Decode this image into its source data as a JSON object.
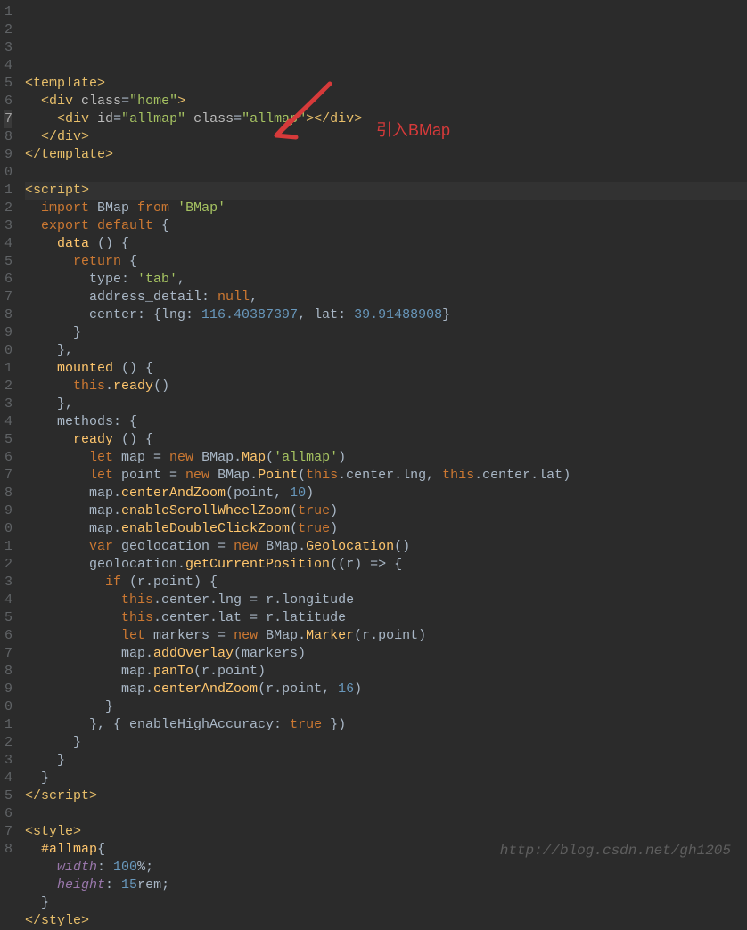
{
  "editor": {
    "highlighted_line": 7,
    "line_numbers": [
      "1",
      "2",
      "3",
      "4",
      "5",
      "6",
      "7",
      "8",
      "9",
      "0",
      "1",
      "2",
      "3",
      "4",
      "5",
      "6",
      "7",
      "8",
      "9",
      "0",
      "1",
      "2",
      "3",
      "4",
      "5",
      "6",
      "7",
      "8",
      "9",
      "0",
      "1",
      "2",
      "3",
      "4",
      "5",
      "6",
      "7",
      "8",
      "9",
      "0",
      "1",
      "2",
      "3",
      "4",
      "5",
      "6",
      "7",
      "8"
    ],
    "lines": {
      "l1": [
        {
          "t": "<",
          "c": "tag"
        },
        {
          "t": "template",
          "c": "tag"
        },
        {
          "t": ">",
          "c": "tag"
        }
      ],
      "l2": [
        {
          "t": "  "
        },
        {
          "t": "<",
          "c": "tag"
        },
        {
          "t": "div ",
          "c": "tag"
        },
        {
          "t": "class",
          "c": "attr"
        },
        {
          "t": "=",
          "c": "op"
        },
        {
          "t": "\"home\"",
          "c": "str"
        },
        {
          "t": ">",
          "c": "tag"
        }
      ],
      "l3": [
        {
          "t": "    "
        },
        {
          "t": "<",
          "c": "tag"
        },
        {
          "t": "div ",
          "c": "tag"
        },
        {
          "t": "id",
          "c": "attr"
        },
        {
          "t": "=",
          "c": "op"
        },
        {
          "t": "\"allmap\"",
          "c": "str"
        },
        {
          "t": " "
        },
        {
          "t": "class",
          "c": "attr"
        },
        {
          "t": "=",
          "c": "op"
        },
        {
          "t": "\"allmap\"",
          "c": "str"
        },
        {
          "t": "></",
          "c": "tag"
        },
        {
          "t": "div",
          "c": "tag"
        },
        {
          "t": ">",
          "c": "tag"
        }
      ],
      "l4": [
        {
          "t": "  "
        },
        {
          "t": "</",
          "c": "tag"
        },
        {
          "t": "div",
          "c": "tag"
        },
        {
          "t": ">",
          "c": "tag"
        }
      ],
      "l5": [
        {
          "t": "</",
          "c": "tag"
        },
        {
          "t": "template",
          "c": "tag"
        },
        {
          "t": ">",
          "c": "tag"
        }
      ],
      "l6": [
        {
          "t": ""
        }
      ],
      "l7": [
        {
          "t": "<",
          "c": "tag"
        },
        {
          "t": "script",
          "c": "tag"
        },
        {
          "t": ">",
          "c": "tag"
        }
      ],
      "l8": [
        {
          "t": "  "
        },
        {
          "t": "import",
          "c": "kw"
        },
        {
          "t": " BMap "
        },
        {
          "t": "from",
          "c": "kw"
        },
        {
          "t": " "
        },
        {
          "t": "'BMap'",
          "c": "str"
        }
      ],
      "l9": [
        {
          "t": "  "
        },
        {
          "t": "export ",
          "c": "kw"
        },
        {
          "t": "default",
          "c": "kw"
        },
        {
          "t": " {"
        }
      ],
      "l10": [
        {
          "t": "    "
        },
        {
          "t": "data",
          "c": "fn"
        },
        {
          "t": " () {"
        }
      ],
      "l11": [
        {
          "t": "      "
        },
        {
          "t": "return",
          "c": "kw"
        },
        {
          "t": " {"
        }
      ],
      "l12": [
        {
          "t": "        type: "
        },
        {
          "t": "'tab'",
          "c": "str"
        },
        {
          "t": ","
        }
      ],
      "l13": [
        {
          "t": "        address_detail: "
        },
        {
          "t": "null",
          "c": "kw"
        },
        {
          "t": ","
        }
      ],
      "l14": [
        {
          "t": "        center: {lng: "
        },
        {
          "t": "116.40387397",
          "c": "num"
        },
        {
          "t": ", lat: "
        },
        {
          "t": "39.91488908",
          "c": "num"
        },
        {
          "t": "}"
        }
      ],
      "l15": [
        {
          "t": "      }"
        }
      ],
      "l16": [
        {
          "t": "    },"
        }
      ],
      "l17": [
        {
          "t": "    "
        },
        {
          "t": "mounted",
          "c": "fn"
        },
        {
          "t": " () {"
        }
      ],
      "l18": [
        {
          "t": "      "
        },
        {
          "t": "this",
          "c": "kw"
        },
        {
          "t": "."
        },
        {
          "t": "ready",
          "c": "fn"
        },
        {
          "t": "()"
        }
      ],
      "l19": [
        {
          "t": "    },"
        }
      ],
      "l20": [
        {
          "t": "    methods: {"
        }
      ],
      "l21": [
        {
          "t": "      "
        },
        {
          "t": "ready",
          "c": "fn"
        },
        {
          "t": " () {"
        }
      ],
      "l22": [
        {
          "t": "        "
        },
        {
          "t": "let",
          "c": "kw"
        },
        {
          "t": " map = "
        },
        {
          "t": "new",
          "c": "kw"
        },
        {
          "t": " BMap."
        },
        {
          "t": "Map",
          "c": "fn"
        },
        {
          "t": "("
        },
        {
          "t": "'allmap'",
          "c": "str"
        },
        {
          "t": ")"
        }
      ],
      "l23": [
        {
          "t": "        "
        },
        {
          "t": "let",
          "c": "kw"
        },
        {
          "t": " point = "
        },
        {
          "t": "new",
          "c": "kw"
        },
        {
          "t": " BMap."
        },
        {
          "t": "Point",
          "c": "fn"
        },
        {
          "t": "("
        },
        {
          "t": "this",
          "c": "kw"
        },
        {
          "t": ".center.lng, "
        },
        {
          "t": "this",
          "c": "kw"
        },
        {
          "t": ".center.lat)"
        }
      ],
      "l24": [
        {
          "t": "        map."
        },
        {
          "t": "centerAndZoom",
          "c": "fn"
        },
        {
          "t": "(point, "
        },
        {
          "t": "10",
          "c": "num"
        },
        {
          "t": ")"
        }
      ],
      "l25": [
        {
          "t": "        map."
        },
        {
          "t": "enableScrollWheelZoom",
          "c": "fn"
        },
        {
          "t": "("
        },
        {
          "t": "true",
          "c": "bool"
        },
        {
          "t": ")"
        }
      ],
      "l26": [
        {
          "t": "        map."
        },
        {
          "t": "enableDoubleClickZoom",
          "c": "fn"
        },
        {
          "t": "("
        },
        {
          "t": "true",
          "c": "bool"
        },
        {
          "t": ")"
        }
      ],
      "l27": [
        {
          "t": "        "
        },
        {
          "t": "var",
          "c": "kw"
        },
        {
          "t": " geolocation = "
        },
        {
          "t": "new",
          "c": "kw"
        },
        {
          "t": " BMap."
        },
        {
          "t": "Geolocation",
          "c": "fn"
        },
        {
          "t": "()"
        }
      ],
      "l28": [
        {
          "t": "        geolocation."
        },
        {
          "t": "getCurrentPosition",
          "c": "fn"
        },
        {
          "t": "((r) => {"
        }
      ],
      "l29": [
        {
          "t": "          "
        },
        {
          "t": "if",
          "c": "kw"
        },
        {
          "t": " (r.point) {"
        }
      ],
      "l30": [
        {
          "t": "            "
        },
        {
          "t": "this",
          "c": "kw"
        },
        {
          "t": ".center.lng = r.longitude"
        }
      ],
      "l31": [
        {
          "t": "            "
        },
        {
          "t": "this",
          "c": "kw"
        },
        {
          "t": ".center.lat = r.latitude"
        }
      ],
      "l32": [
        {
          "t": "            "
        },
        {
          "t": "let",
          "c": "kw"
        },
        {
          "t": " markers = "
        },
        {
          "t": "new",
          "c": "kw"
        },
        {
          "t": " BMap."
        },
        {
          "t": "Marker",
          "c": "fn"
        },
        {
          "t": "(r.point)"
        }
      ],
      "l33": [
        {
          "t": "            map."
        },
        {
          "t": "addOverlay",
          "c": "fn"
        },
        {
          "t": "(markers)"
        }
      ],
      "l34": [
        {
          "t": "            map."
        },
        {
          "t": "panTo",
          "c": "fn"
        },
        {
          "t": "(r.point)"
        }
      ],
      "l35": [
        {
          "t": "            map."
        },
        {
          "t": "centerAndZoom",
          "c": "fn"
        },
        {
          "t": "(r.point, "
        },
        {
          "t": "16",
          "c": "num"
        },
        {
          "t": ")"
        }
      ],
      "l36": [
        {
          "t": "          }"
        }
      ],
      "l37": [
        {
          "t": "        }, { enableHighAccuracy: "
        },
        {
          "t": "true",
          "c": "bool"
        },
        {
          "t": " })"
        }
      ],
      "l38": [
        {
          "t": "      }"
        }
      ],
      "l39": [
        {
          "t": "    }"
        }
      ],
      "l40": [
        {
          "t": "  }"
        }
      ],
      "l41": [
        {
          "t": "</",
          "c": "tag"
        },
        {
          "t": "script",
          "c": "tag"
        },
        {
          "t": ">",
          "c": "tag"
        }
      ],
      "l42": [
        {
          "t": ""
        }
      ],
      "l43": [
        {
          "t": "<",
          "c": "tag"
        },
        {
          "t": "style",
          "c": "tag"
        },
        {
          "t": ">",
          "c": "tag"
        }
      ],
      "l44": [
        {
          "t": "  "
        },
        {
          "t": "#allmap",
          "c": "id"
        },
        {
          "t": "{"
        }
      ],
      "l45": [
        {
          "t": "    "
        },
        {
          "t": "width",
          "c": "prop it"
        },
        {
          "t": ": "
        },
        {
          "t": "100",
          "c": "num"
        },
        {
          "t": "%;",
          "c": "op"
        }
      ],
      "l46": [
        {
          "t": "    "
        },
        {
          "t": "height",
          "c": "prop it"
        },
        {
          "t": ": "
        },
        {
          "t": "15",
          "c": "num"
        },
        {
          "t": "rem;",
          "c": "op"
        }
      ],
      "l47": [
        {
          "t": "  }"
        }
      ],
      "l48": [
        {
          "t": "</",
          "c": "tag"
        },
        {
          "t": "style",
          "c": "tag"
        },
        {
          "t": ">",
          "c": "tag"
        }
      ]
    }
  },
  "annotation": {
    "text": "引入BMap"
  },
  "watermark": "http://blog.csdn.net/gh1205"
}
